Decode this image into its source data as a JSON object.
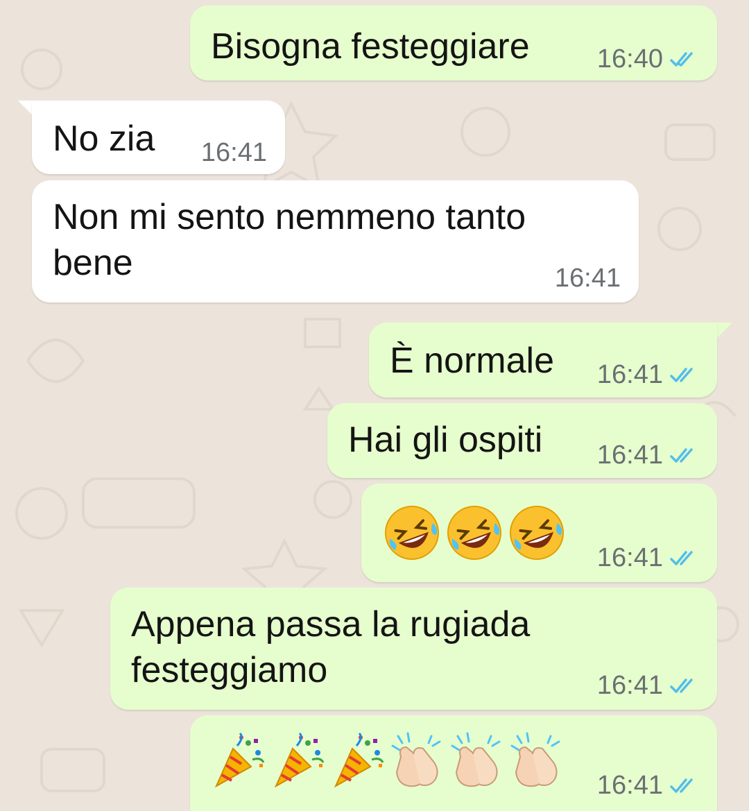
{
  "chat": {
    "colors": {
      "outgoing_bubble": "#e6fecd",
      "incoming_bubble": "#ffffff",
      "background": "#ece4db",
      "read_ticks": "#53bdeb",
      "timestamp": "#6a6f72"
    },
    "messages": [
      {
        "direction": "outgoing",
        "text": "Bisogna festeggiare",
        "time": "16:40",
        "status": "read"
      },
      {
        "direction": "incoming",
        "text": "No zia",
        "time": "16:41"
      },
      {
        "direction": "incoming",
        "lines": [
          "Non mi sento nemmeno tanto",
          "bene"
        ],
        "time": "16:41"
      },
      {
        "direction": "outgoing",
        "text": "È normale",
        "time": "16:41",
        "status": "read"
      },
      {
        "direction": "outgoing",
        "text": "Hai gli ospiti",
        "time": "16:41",
        "status": "read"
      },
      {
        "direction": "outgoing",
        "emoji": [
          "rolling-on-floor-laughing",
          "rolling-on-floor-laughing",
          "rolling-on-floor-laughing"
        ],
        "time": "16:41",
        "status": "read"
      },
      {
        "direction": "outgoing",
        "lines": [
          "Appena passa la rugiada",
          "festeggiamo"
        ],
        "time": "16:41",
        "status": "read"
      },
      {
        "direction": "outgoing",
        "emoji": [
          "party-popper",
          "party-popper",
          "party-popper",
          "clapping-hands",
          "clapping-hands",
          "clapping-hands"
        ],
        "time": "16:41",
        "status": "read"
      }
    ]
  }
}
